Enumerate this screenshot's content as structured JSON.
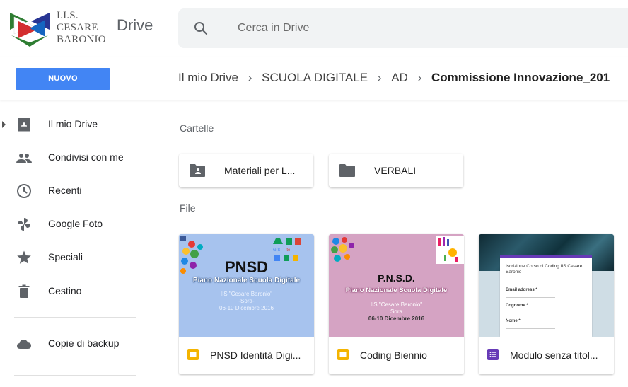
{
  "header": {
    "logo_lines": [
      "I.I.S.",
      "CESARE",
      "BARONIO"
    ],
    "app_title": "Drive",
    "search_placeholder": "Cerca in Drive"
  },
  "toolbar": {
    "new_label": "NUOVO"
  },
  "breadcrumb": [
    "Il mio Drive",
    "SCUOLA DIGITALE",
    "AD",
    "Commissione Innovazione_201"
  ],
  "sidebar": {
    "items": [
      {
        "label": "Il mio Drive",
        "icon": "my-drive-icon"
      },
      {
        "label": "Condivisi con me",
        "icon": "shared-people-icon"
      },
      {
        "label": "Recenti",
        "icon": "clock-icon"
      },
      {
        "label": "Google Foto",
        "icon": "pinwheel-icon"
      },
      {
        "label": "Speciali",
        "icon": "star-icon"
      },
      {
        "label": "Cestino",
        "icon": "trash-icon"
      },
      {
        "label": "Copie di backup",
        "icon": "cloud-icon"
      }
    ]
  },
  "main": {
    "folders_label": "Cartelle",
    "files_label": "File",
    "folders": [
      {
        "name": "Materiali per L...",
        "icon": "shared-folder-icon"
      },
      {
        "name": "VERBALI",
        "icon": "folder-icon"
      }
    ],
    "files": [
      {
        "name": "PNSD Identità Digi...",
        "type_icon": "slides-icon",
        "thumb": {
          "title": "PNSD",
          "subtitle": "Piano Nazionale Scuola Digitale",
          "lines": [
            "IIS \"Cesare Baronio\"",
            "-Sora-",
            "06-10 Dicembre 2016"
          ]
        }
      },
      {
        "name": "Coding Biennio",
        "type_icon": "slides-icon",
        "thumb": {
          "title": "P.N.S.D.",
          "subtitle": "Piano Nazionale Scuola Digitale",
          "lines": [
            "IIS \"Cesare Baronio\"",
            "Sora",
            "06-10 Dicembre 2016"
          ]
        }
      },
      {
        "name": "Modulo senza titol...",
        "type_icon": "forms-icon",
        "thumb": {
          "title": "Iscrizione Corso di Coding IIS Cesare Baronio",
          "fields": [
            "Email address *",
            "Cognome *",
            "Nome *"
          ]
        }
      }
    ]
  },
  "colors": {
    "accent_blue": "#4285f4",
    "slides_yellow": "#f4b400",
    "forms_purple": "#673ab7",
    "icon_grey": "#5f6368"
  }
}
